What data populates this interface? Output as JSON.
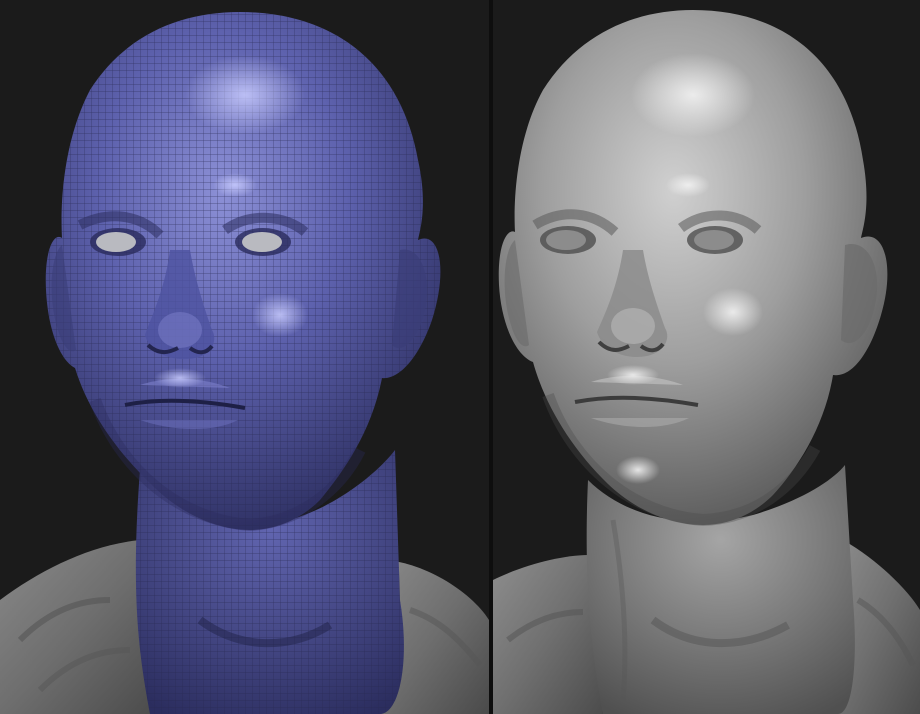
{
  "scene": {
    "background_color": "#1b1b1b",
    "panels": [
      {
        "id": "wireframe-view",
        "description_icon": "polygon-mesh-icon",
        "material": "blue-wireframe",
        "skin_color": "#5b5fa6",
        "wire_color": "#2c2e5c"
      },
      {
        "id": "shaded-view",
        "description_icon": "sculpt-icon",
        "material": "gray-clay",
        "skin_color": "#9a9a9a"
      }
    ],
    "shirt_color": "#7d7d7d"
  }
}
